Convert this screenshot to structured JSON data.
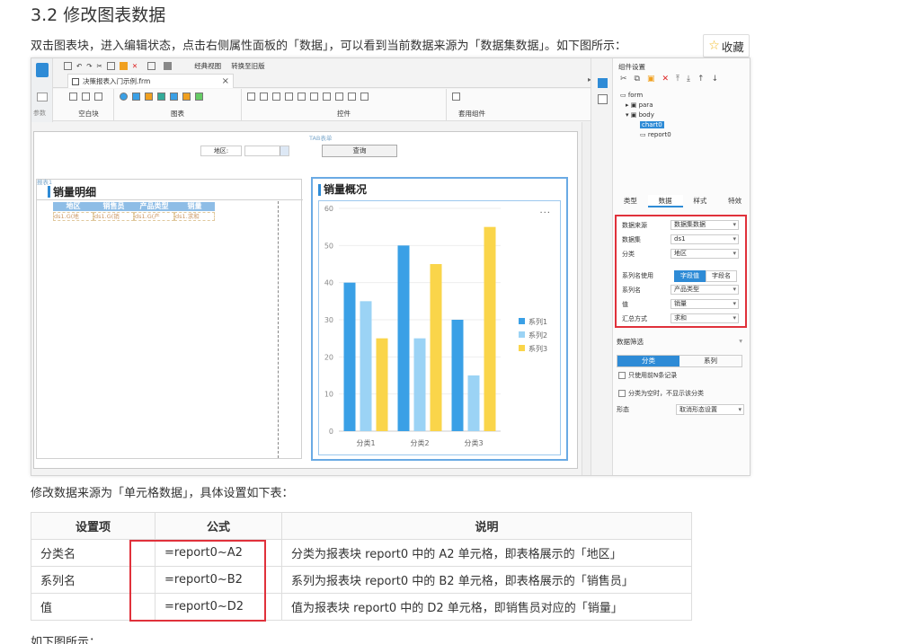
{
  "doc": {
    "title": "3.2 修改图表数据",
    "intro": "双击图表块，进入编辑状态，点击右侧属性面板的「数据」，可以看到当前数据来源为「数据集数据」。如下图所示：",
    "fav_label": "收藏",
    "desc2": "修改数据来源为「单元格数据」，具体设置如下表：",
    "bottom_note": "如下图所示："
  },
  "designer": {
    "toolbar": {
      "classic_view": "经典视图",
      "convert_report": "转换至旧版"
    },
    "file_tab": "决策报表入门示例.frm",
    "ribbon_groups": [
      "空白块",
      "图表",
      "控件",
      "套用组件"
    ],
    "side_label": "参数",
    "param_link": "TAB表单",
    "region_label": "地区:",
    "query_button": "查询",
    "report": {
      "tag": "报表1",
      "title": "销量明细",
      "headers": [
        "地区",
        "销售员",
        "产品类型",
        "销量"
      ],
      "row": [
        "ds1.G(地",
        "ds1.G(销",
        "ds1.G(产",
        "ds1.求和"
      ]
    },
    "chart": {
      "title": "销量概况",
      "more": "···"
    },
    "panel": {
      "title": "组件设置",
      "tree": [
        "form",
        "para",
        "body",
        "chart0",
        "report0"
      ],
      "tabs": [
        "类型",
        "数据",
        "样式",
        "特效"
      ],
      "rows": [
        {
          "label": "数据来源",
          "value": "数据集数据"
        },
        {
          "label": "数据集",
          "value": "ds1"
        },
        {
          "label": "分类",
          "value": "地区"
        },
        {
          "label": "系列名使用",
          "value": ""
        },
        {
          "label": "系列名",
          "value": "产品类型"
        },
        {
          "label": "值",
          "value": "销量"
        },
        {
          "label": "汇总方式",
          "value": "求和"
        }
      ],
      "series_toggle": [
        "字段值",
        "字段名"
      ],
      "filter_title": "数据筛选",
      "filter_tabs": [
        "分类",
        "系列"
      ],
      "check1": "只使用前N条记录",
      "check2": "分类为空时，不显示该分类",
      "shape_label": "形态",
      "shape_value": "取消形态设置"
    }
  },
  "chart_data": {
    "type": "bar",
    "categories": [
      "分类1",
      "分类2",
      "分类3"
    ],
    "series": [
      {
        "name": "系列1",
        "values": [
          40,
          50,
          30
        ],
        "color": "#3aa0e6"
      },
      {
        "name": "系列2",
        "values": [
          35,
          25,
          15
        ],
        "color": "#9bd3f5"
      },
      {
        "name": "系列3",
        "values": [
          25,
          45,
          55
        ],
        "color": "#fad54a"
      }
    ],
    "ylim": [
      0,
      60
    ],
    "yticks": [
      0,
      10,
      20,
      30,
      40,
      50,
      60
    ],
    "grid": true,
    "legend": "right"
  },
  "table": {
    "headers": [
      "设置项",
      "公式",
      "说明"
    ],
    "rows": [
      [
        "分类名",
        "=report0~A2",
        "分类为报表块 report0 中的 A2 单元格，即表格展示的「地区」"
      ],
      [
        "系列名",
        "=report0~B2",
        "系列为报表块 report0 中的 B2 单元格，即表格展示的「销售员」"
      ],
      [
        "值",
        "=report0~D2",
        "值为报表块 report0 中的 D2 单元格，即销售员对应的「销量」"
      ]
    ]
  }
}
